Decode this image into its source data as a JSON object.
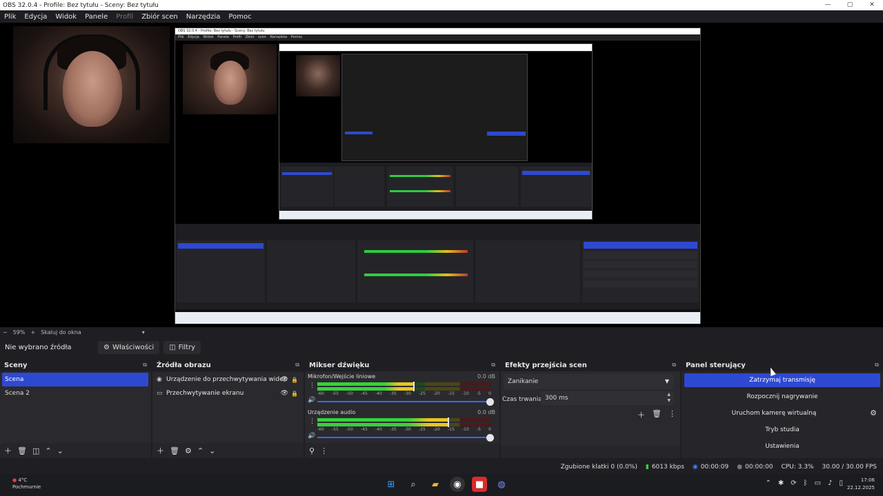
{
  "window": {
    "title": "OBS 32.0.4 - Profile: Bez tytułu - Sceny: Bez tytułu",
    "minimize": "—",
    "maximize": "▢",
    "close": "✕"
  },
  "menu": {
    "items": [
      "Plik",
      "Edycja",
      "Widok",
      "Panele",
      "Profil",
      "Zbiór scen",
      "Narzędzia",
      "Pomoc"
    ]
  },
  "zoom": {
    "minus": "−",
    "level": "59%",
    "plus": "+",
    "fit_label": "Skaluj do okna"
  },
  "source_toolbar": {
    "no_source": "Nie wybrano źródła",
    "properties_label": "Właściwości",
    "filters_label": "Filtry",
    "properties_icon": "gear-icon",
    "filters_icon": "filter-icon"
  },
  "scenes": {
    "title": "Sceny",
    "items": [
      {
        "label": "Scena",
        "selected": true
      },
      {
        "label": "Scena 2",
        "selected": false
      }
    ]
  },
  "sources": {
    "title": "Źródła obrazu",
    "items": [
      {
        "label": "Urządzenie do przechwytywania wideo",
        "icon": "camera-icon"
      },
      {
        "label": "Przechwytywanie ekranu",
        "icon": "monitor-icon"
      }
    ]
  },
  "mixer": {
    "title": "Mikser dźwięku",
    "ticks": [
      "-60",
      "-55",
      "-50",
      "-45",
      "-40",
      "-35",
      "-30",
      "-25",
      "-20",
      "-15",
      "-10",
      "-5",
      "0"
    ],
    "tracks": [
      {
        "name": "Mikrofon/Wejście liniowe",
        "db": "0.0 dB",
        "level": 0.55,
        "volume": 1.0
      },
      {
        "name": "Urządzenie audio",
        "db": "0.0 dB",
        "level": 0.75,
        "volume": 1.0
      }
    ]
  },
  "transitions": {
    "title": "Efekty przejścia scen",
    "selected": "Zanikanie",
    "duration_label": "Czas trwania",
    "duration_value": "300 ms"
  },
  "controls": {
    "title": "Panel sterujący",
    "stop_stream": "Zatrzymaj transmisję",
    "start_record": "Rozpocznij nagrywanie",
    "virtual_cam": "Uruchom kamerę wirtualną",
    "studio_mode": "Tryb studia",
    "settings": "Ustawienia"
  },
  "status": {
    "dropped": "Zgubione klatki 0 (0.0%)",
    "bitrate": "6013 kbps",
    "stream_time": "00:00:09",
    "record_time": "00:00:00",
    "cpu": "CPU: 3.3%",
    "fps": "30.00 / 30.00 FPS"
  },
  "taskbar": {
    "temperature": "4°C",
    "weather": "Pochmurnie",
    "time": "17:06",
    "date": "22.12.2025"
  },
  "nested": {
    "title": "OBS 32.0.4 - Profile: Bez tytułu - Sceny: Bez tytułu",
    "menu": "Plik Edycja Widok Panele Profil Zbiór scen Narzędzia Pomoc"
  },
  "colors": {
    "accent": "#2e49d1",
    "background": "#1f1f23",
    "meter_green": "#38d13a",
    "meter_yellow": "#e6c522",
    "meter_red": "#c0392b"
  }
}
